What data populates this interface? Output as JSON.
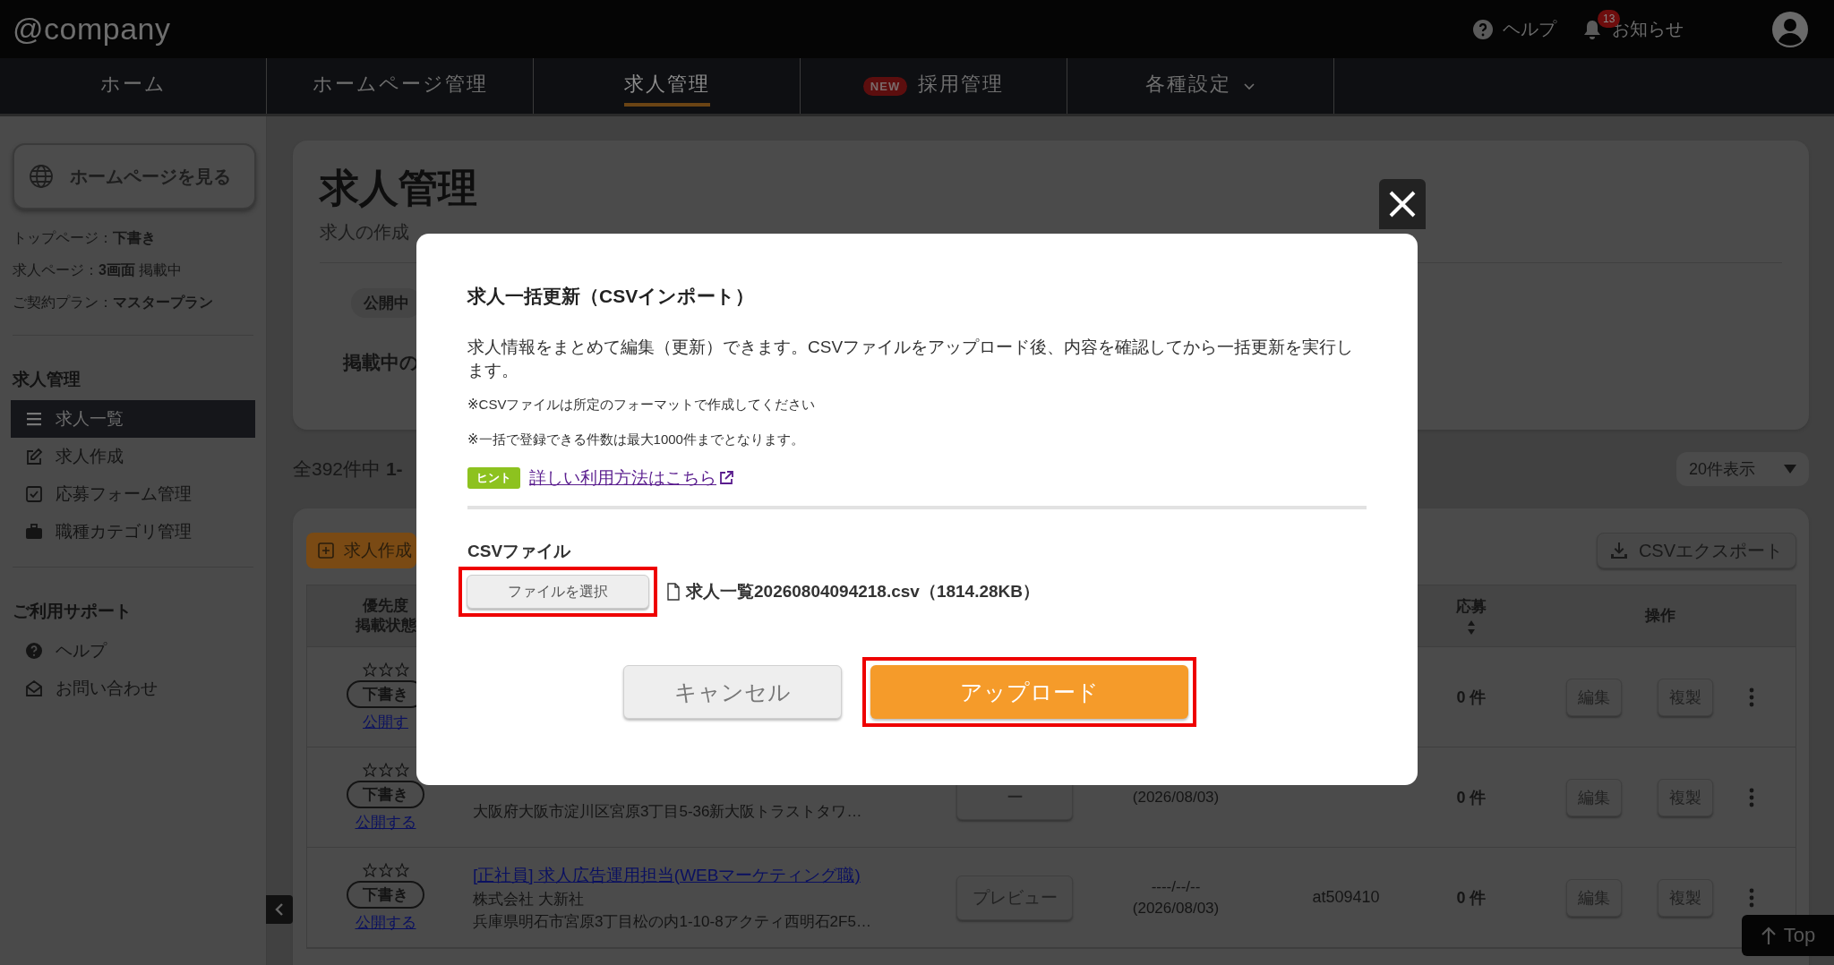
{
  "header": {
    "logo": "@company",
    "help": "ヘルプ",
    "notice_count": "13",
    "notice": "お知らせ"
  },
  "nav": [
    {
      "label": "ホーム",
      "selected": false
    },
    {
      "label": "ホームページ管理",
      "selected": false
    },
    {
      "label": "求人管理",
      "selected": true
    },
    {
      "label": "採用管理",
      "badge": "NEW",
      "selected": false
    },
    {
      "label": "各種設定",
      "dropdown": true,
      "selected": false
    }
  ],
  "sidebar": {
    "view_button": "ホームページを見る",
    "info": [
      "トップページ：**下書き**",
      "求人ページ：**3画面** 掲載中",
      "ご契約プラン：**マスタープラン**"
    ],
    "sections": [
      {
        "title": "求人管理",
        "items": [
          {
            "label": "求人一覧",
            "selected": true
          },
          {
            "label": "求人作成",
            "selected": false
          },
          {
            "label": "応募フォーム管理",
            "selected": false
          },
          {
            "label": "職種カテゴリ管理",
            "selected": false
          }
        ]
      },
      {
        "title": "ご利用サポート",
        "items": [
          {
            "label": "ヘルプ",
            "selected": false
          },
          {
            "label": "お問い合わせ",
            "selected": false
          }
        ]
      }
    ]
  },
  "page": {
    "title": "求人管理",
    "subtitle": "求人の作成",
    "status_pill": "公開中",
    "published_label": "掲載中の",
    "count": "全392件中 **1-**",
    "per_page": "20件表示",
    "create_button": "求人作成",
    "export_button": "CSVエクスポート"
  },
  "table": {
    "columns": {
      "status": [
        "優先度",
        "掲載状態"
      ],
      "applications": "応募",
      "actions": "操作"
    },
    "rows": [
      {
        "stars": 0,
        "status": "下書き",
        "publish_link": "公開す",
        "applications": "0 件",
        "edit": "編集",
        "copy": "複製"
      },
      {
        "stars": 0,
        "status": "下書き",
        "publish_link": "公開する",
        "address": "大阪府大阪市淀川区宮原3丁目5-36新大阪トラストタワ…",
        "preview": "ー",
        "deadline": "(2026/08/03)",
        "applications": "0 件",
        "edit": "編集",
        "copy": "複製"
      },
      {
        "stars": 0,
        "status": "下書き",
        "publish_link": "公開する",
        "title": "[正社員] 求人広告運用担当(WEBマーケティング職)",
        "company": "株式会社 大新社",
        "address": "兵庫県明石市宮原3丁目松の内1-10-8アクティ西明石2F5…",
        "preview": "プレビュー",
        "posted_date": "----/--/--",
        "deadline": "(2026/08/03)",
        "id": "at509410",
        "applications": "0 件",
        "edit": "編集",
        "copy": "複製"
      }
    ]
  },
  "modal": {
    "title": "求人一括更新（CSVインポート）",
    "description": "求人情報をまとめて編集（更新）できます。CSVファイルをアップロード後、内容を確認してから一括更新を実行します。",
    "notes": [
      "※CSVファイルは所定のフォーマットで作成してください",
      "※一括で登録できる件数は最大1000件までとなります。"
    ],
    "hint": {
      "badge": "ヒント",
      "link": "詳しい利用方法はこちら"
    },
    "file_label": "CSVファイル",
    "file_button": {
      "label": "ファイルを選択",
      "highlighted": true
    },
    "file_name": "求人一覧20260804094218.csv（1814.28KB）",
    "cancel_button": {
      "label": "キャンセル",
      "highlighted": false
    },
    "upload_button": {
      "label": "アップロード",
      "highlighted": true
    }
  },
  "top_button": "Top"
}
